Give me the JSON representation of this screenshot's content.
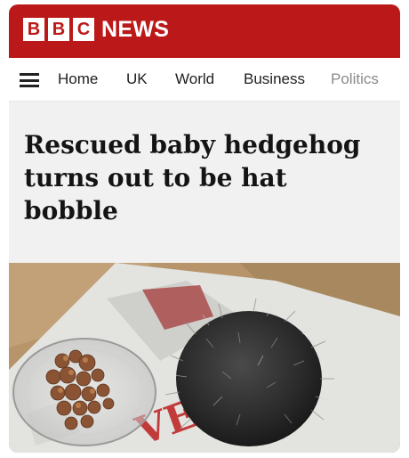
{
  "brand": {
    "letters": [
      "B",
      "B",
      "C"
    ],
    "word": "NEWS",
    "color": "#bb1919"
  },
  "nav": {
    "menu_icon": "hamburger-menu-icon",
    "items": [
      {
        "label": "Home"
      },
      {
        "label": "UK"
      },
      {
        "label": "World"
      },
      {
        "label": "Business"
      },
      {
        "label": "Politics"
      }
    ]
  },
  "article": {
    "headline": "Rescued baby hedgehog turns out to be hat bobble"
  },
  "photo": {
    "newspaper_fragment": "VE"
  }
}
